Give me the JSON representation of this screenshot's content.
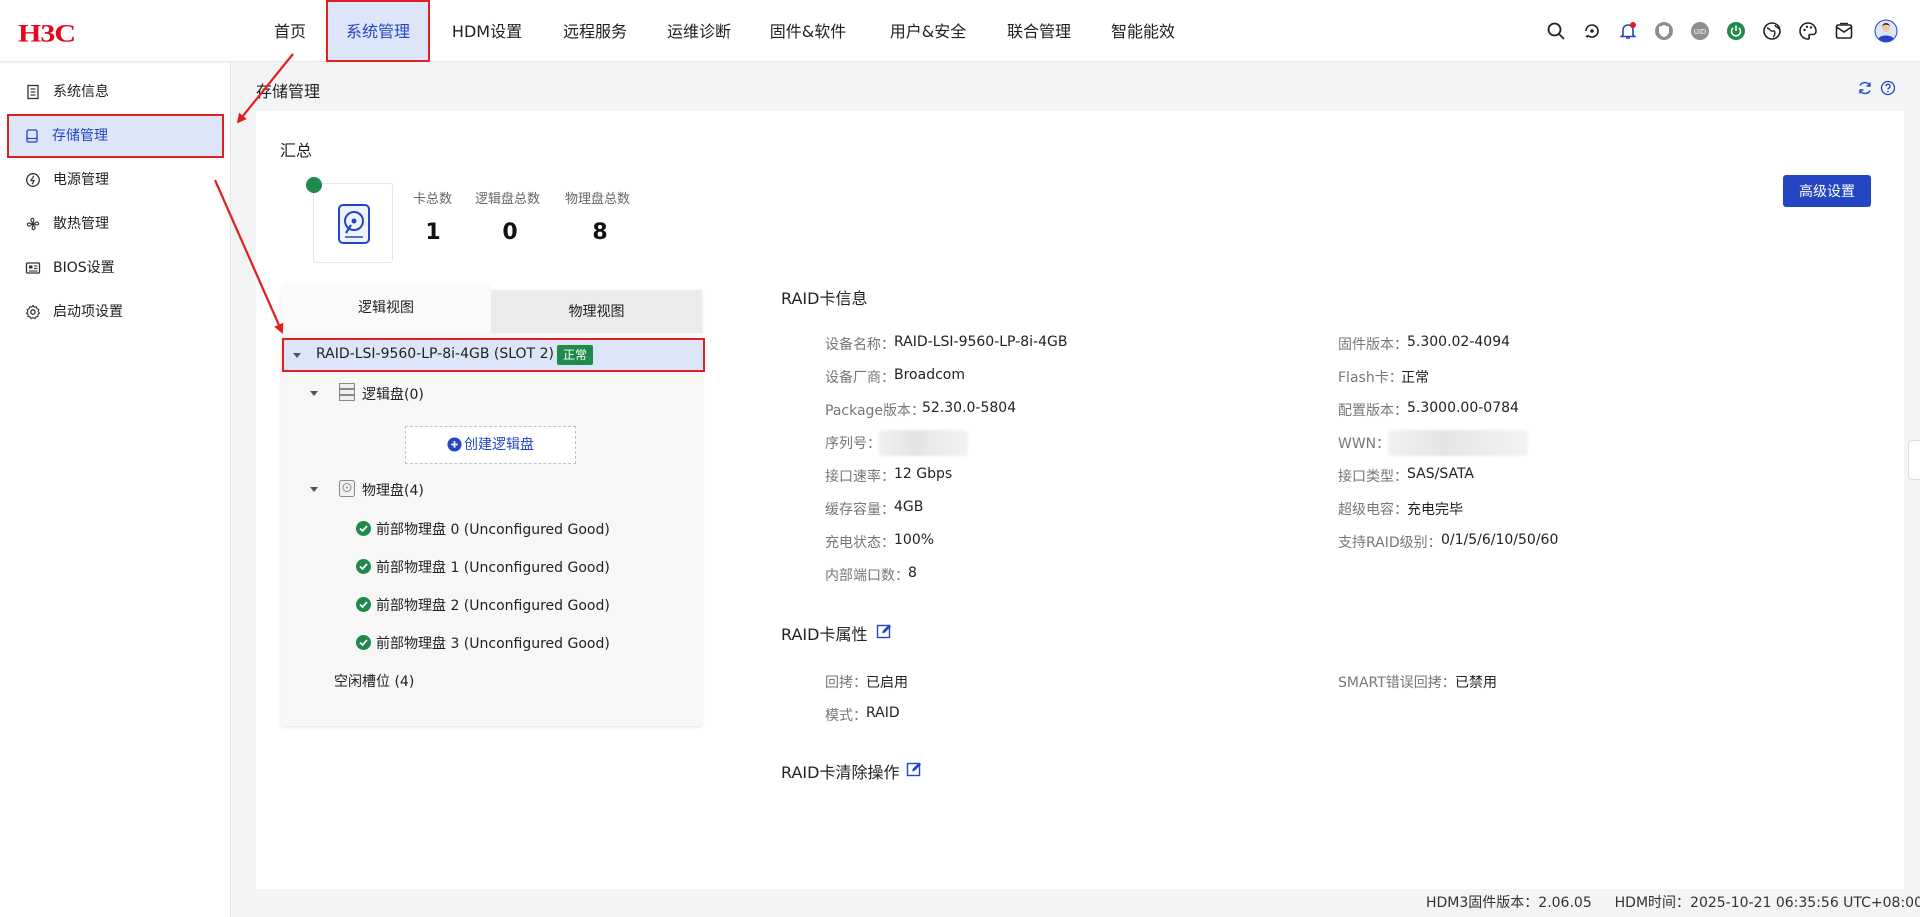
{
  "brand": {
    "logo_text": "H3C"
  },
  "nav": {
    "items": [
      {
        "label": "首页"
      },
      {
        "label": "系统管理"
      },
      {
        "label": "HDM设置"
      },
      {
        "label": "远程服务"
      },
      {
        "label": "运维诊断"
      },
      {
        "label": "固件&软件"
      },
      {
        "label": "用户&安全"
      },
      {
        "label": "联合管理"
      },
      {
        "label": "智能能效"
      }
    ],
    "active": "系统管理",
    "toolbar_icons": [
      "search-icon",
      "refresh-cycle-icon",
      "bell-icon",
      "shield-icon",
      "uid-icon",
      "power-icon",
      "language-globe-icon",
      "theme-palette-icon",
      "message-icon",
      "user-avatar-icon"
    ]
  },
  "sidebar": {
    "items": [
      {
        "label": "系统信息",
        "icon": "document-icon"
      },
      {
        "label": "存储管理",
        "icon": "disk-icon"
      },
      {
        "label": "电源管理",
        "icon": "power-icon"
      },
      {
        "label": "散热管理",
        "icon": "fan-icon"
      },
      {
        "label": "BIOS设置",
        "icon": "bios-icon"
      },
      {
        "label": "启动项设置",
        "icon": "gear-icon"
      }
    ],
    "active": "存储管理"
  },
  "page": {
    "title": "存储管理"
  },
  "summary": {
    "title": "汇总",
    "stats": [
      {
        "label": "卡总数",
        "value": "1"
      },
      {
        "label": "逻辑盘总数",
        "value": "0"
      },
      {
        "label": "物理盘总数",
        "value": "8"
      }
    ],
    "advanced_button": "高级设置"
  },
  "tabs": {
    "logical": "逻辑视图",
    "physical": "物理视图",
    "active": "逻辑视图"
  },
  "tree": {
    "controller": "RAID-LSI-9560-LP-8i-4GB (SLOT 2)",
    "controller_status": "正常",
    "logical_group": "逻辑盘(0)",
    "create_logical": "创建逻辑盘",
    "physical_group": "物理盘(4)",
    "physical_disks": [
      "前部物理盘 0 (Unconfigured Good)",
      "前部物理盘 1 (Unconfigured Good)",
      "前部物理盘 2 (Unconfigured Good)",
      "前部物理盘 3 (Unconfigured Good)"
    ],
    "free_slots": "空闲槽位 (4)"
  },
  "raid_info": {
    "title": "RAID卡信息",
    "left": [
      {
        "label": "设备名称：",
        "value": "RAID-LSI-9560-LP-8i-4GB"
      },
      {
        "label": "设备厂商：",
        "value": "Broadcom"
      },
      {
        "label": "Package版本：",
        "value": "52.30.0-5804"
      },
      {
        "label": "序列号：",
        "value": ""
      },
      {
        "label": "接口速率：",
        "value": "12 Gbps"
      },
      {
        "label": "缓存容量：",
        "value": "4GB"
      },
      {
        "label": "充电状态：",
        "value": "100%"
      },
      {
        "label": "内部端口数：",
        "value": "8"
      }
    ],
    "right": [
      {
        "label": "固件版本：",
        "value": "5.300.02-4094"
      },
      {
        "label": "Flash卡：",
        "value": "正常"
      },
      {
        "label": "配置版本：",
        "value": "5.3000.00-0784"
      },
      {
        "label": "WWN：",
        "value": ""
      },
      {
        "label": "接口类型：",
        "value": "SAS/SATA"
      },
      {
        "label": "超级电容：",
        "value": "充电完毕"
      },
      {
        "label": "支持RAID级别：",
        "value": "0/1/5/6/10/50/60"
      }
    ]
  },
  "raid_props": {
    "title": "RAID卡属性",
    "left": [
      {
        "label": "回拷：",
        "value": "已启用"
      },
      {
        "label": "模式：",
        "value": "RAID"
      }
    ],
    "right": [
      {
        "label": "SMART错误回拷：",
        "value": "已禁用"
      }
    ]
  },
  "raid_clear": {
    "title": "RAID卡清除操作"
  },
  "footer": {
    "fw_label": "HDM3固件版本：",
    "fw_value": "2.06.05",
    "time_label": "HDM时间：",
    "time_value": "2025-10-21 06:35:56 UTC+08:00"
  },
  "colors": {
    "accent": "#2446c4",
    "ok": "#1f8a4c",
    "annotation": "#e02020",
    "brand": "#e3061e"
  }
}
